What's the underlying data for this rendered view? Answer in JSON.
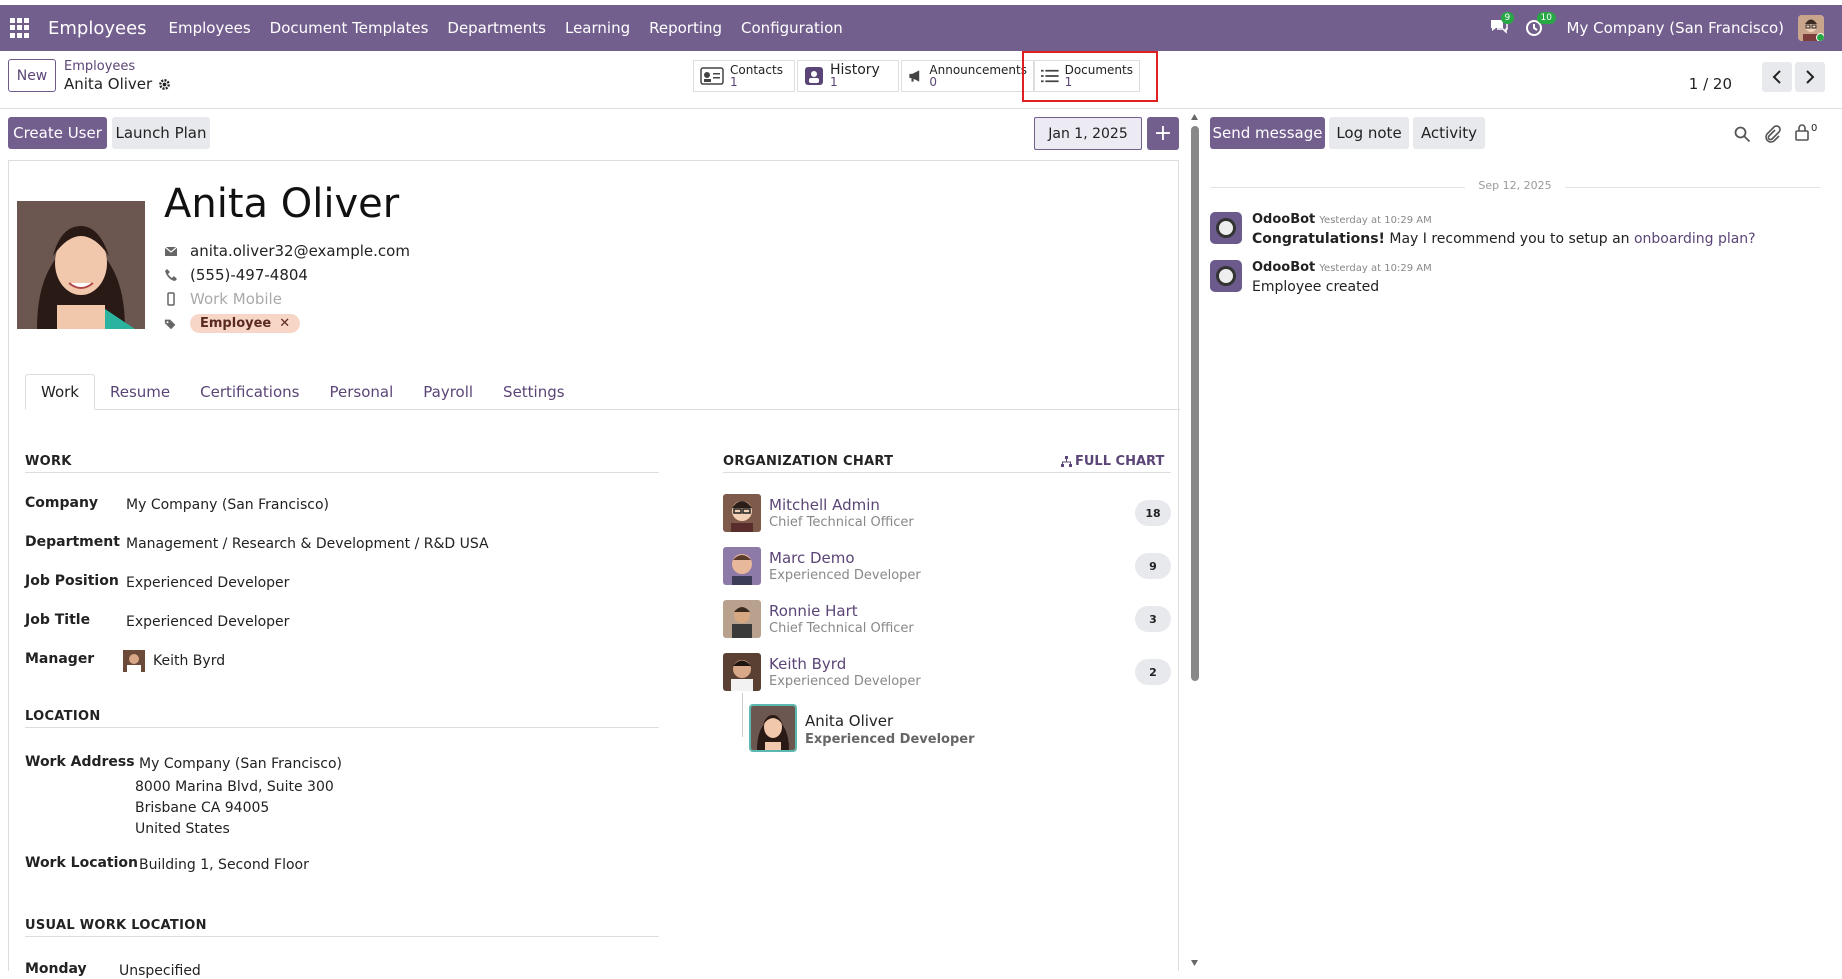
{
  "topbar": {
    "brand": "Employees",
    "menu": [
      "Employees",
      "Document Templates",
      "Departments",
      "Learning",
      "Reporting",
      "Configuration"
    ],
    "messages_count": "9",
    "activities_count": "10",
    "company": "My Company (San Francisco)"
  },
  "control_panel": {
    "new_label": "New",
    "breadcrumb_parent": "Employees",
    "breadcrumb_current": "Anita Oliver",
    "smart_buttons": [
      {
        "label": "Contacts",
        "count": "1"
      },
      {
        "label": "History",
        "count": "1"
      },
      {
        "label": "Announcements",
        "count": "0"
      },
      {
        "label": "Documents",
        "count": "1"
      }
    ],
    "pager": "1 / 20"
  },
  "actions": {
    "create_user": "Create User",
    "launch_plan": "Launch Plan",
    "date": "Jan 1, 2025",
    "plus": "+"
  },
  "employee": {
    "name": "Anita Oliver",
    "email": "anita.oliver32@example.com",
    "phone": "(555)-497-4804",
    "mobile_placeholder": "Work Mobile",
    "tag": "Employee"
  },
  "tabs": [
    "Work",
    "Resume",
    "Certifications",
    "Personal",
    "Payroll",
    "Settings"
  ],
  "work": {
    "title": "WORK",
    "fields": [
      {
        "label": "Company",
        "value": "My Company (San Francisco)"
      },
      {
        "label": "Department",
        "value": "Management / Research & Development / R&D USA"
      },
      {
        "label": "Job Position",
        "value": "Experienced Developer"
      },
      {
        "label": "Job Title",
        "value": "Experienced Developer"
      },
      {
        "label": "Manager",
        "value": "Keith Byrd"
      }
    ]
  },
  "location": {
    "title": "LOCATION",
    "work_address_label": "Work Address",
    "address_lines": [
      "My Company (San Francisco)",
      "8000 Marina Blvd, Suite 300",
      "Brisbane CA 94005",
      "United States"
    ],
    "work_location_label": "Work Location",
    "work_location": "Building 1, Second Floor"
  },
  "usual": {
    "title": "USUAL WORK LOCATION",
    "monday_label": "Monday",
    "monday_value": "Unspecified"
  },
  "org_chart": {
    "title": "ORGANIZATION CHART",
    "full_chart": "FULL CHART",
    "rows": [
      {
        "name": "Mitchell Admin",
        "job": "Chief Technical Officer",
        "count": "18"
      },
      {
        "name": "Marc Demo",
        "job": "Experienced Developer",
        "count": "9"
      },
      {
        "name": "Ronnie Hart",
        "job": "Chief Technical Officer",
        "count": "3"
      },
      {
        "name": "Keith Byrd",
        "job": "Experienced Developer",
        "count": "2"
      }
    ],
    "self": {
      "name": "Anita Oliver",
      "job": "Experienced Developer"
    }
  },
  "chatter": {
    "send_message": "Send message",
    "log_note": "Log note",
    "activity": "Activity",
    "followers": "0",
    "date_sep": "Sep 12, 2025",
    "messages": [
      {
        "author": "OdooBot",
        "time": "Yesterday at 10:29 AM",
        "bold": "Congratulations!",
        "text": " May I recommend you to setup an ",
        "link": "onboarding plan?"
      },
      {
        "author": "OdooBot",
        "time": "Yesterday at 10:29 AM",
        "text": "Employee created"
      }
    ]
  },
  "colors": {
    "brand": "#735f8e",
    "link": "#5b4577",
    "highlight": "#e02020",
    "tag": "#f7d6c8"
  }
}
